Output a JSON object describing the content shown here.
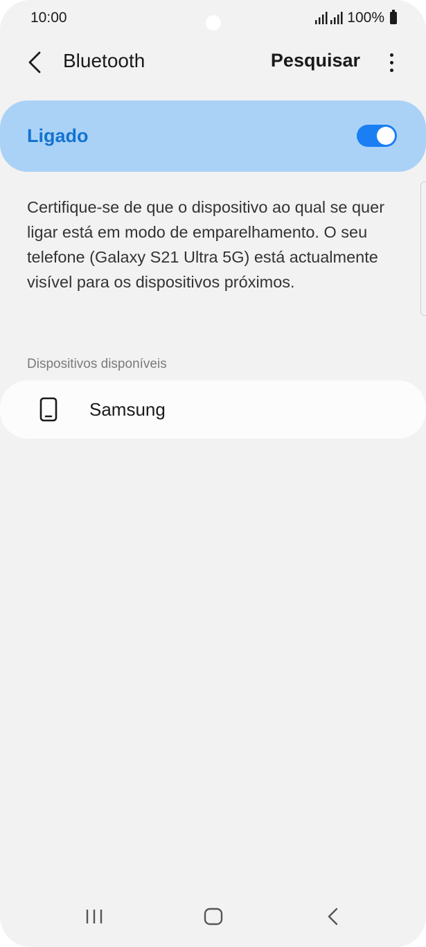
{
  "status_bar": {
    "time": "10:00",
    "battery_text": "100%"
  },
  "header": {
    "title": "Bluetooth",
    "search_label": "Pesquisar"
  },
  "toggle": {
    "label": "Ligado",
    "state": "on",
    "accent_color": "#1a7ff2"
  },
  "description": "Certifique-se de que o dispositivo ao qual se quer ligar está em modo de emparelhamento. O seu telefone (Galaxy S21 Ultra 5G) está actualmente visível para os dispositivos próximos.",
  "available_devices": {
    "section_title": "Dispositivos disponíveis",
    "items": [
      {
        "name": "Samsung",
        "icon": "smartphone-icon"
      }
    ]
  },
  "nav_bar": {
    "icons": [
      "recent-apps-icon",
      "home-icon",
      "back-icon"
    ]
  }
}
